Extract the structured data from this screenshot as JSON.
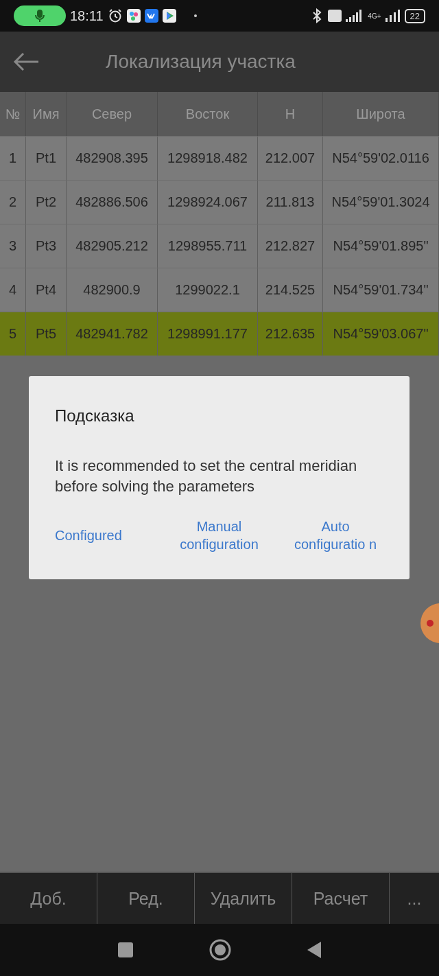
{
  "status_bar": {
    "time": "18:11",
    "battery": "22",
    "network": "4G+"
  },
  "app_bar": {
    "title": "Локализация участка"
  },
  "table": {
    "columns": [
      "№",
      "Имя",
      "Север",
      "Восток",
      "H",
      "Широта"
    ],
    "rows": [
      {
        "cells": [
          "1",
          "Pt1",
          "482908.395",
          "1298918.482",
          "212.007",
          "N54°59'02.0116"
        ],
        "selected": false
      },
      {
        "cells": [
          "2",
          "Pt2",
          "482886.506",
          "1298924.067",
          "211.813",
          "N54°59'01.3024"
        ],
        "selected": false
      },
      {
        "cells": [
          "3",
          "Pt3",
          "482905.212",
          "1298955.711",
          "212.827",
          "N54°59'01.895\""
        ],
        "selected": false
      },
      {
        "cells": [
          "4",
          "Pt4",
          "482900.9",
          "1299022.1",
          "214.525",
          "N54°59'01.734\""
        ],
        "selected": false
      },
      {
        "cells": [
          "5",
          "Pt5",
          "482941.782",
          "1298991.177",
          "212.635",
          "N54°59'03.067\""
        ],
        "selected": true
      }
    ]
  },
  "dialog": {
    "title": "Подсказка",
    "message": "It is recommended to set the central meridian before solving the parameters",
    "buttons": [
      "Configured",
      "Manual configuration",
      "Auto configuratio n"
    ]
  },
  "bottom_bar": [
    "Доб.",
    "Ред.",
    "Удалить",
    "Расчет",
    "..."
  ]
}
